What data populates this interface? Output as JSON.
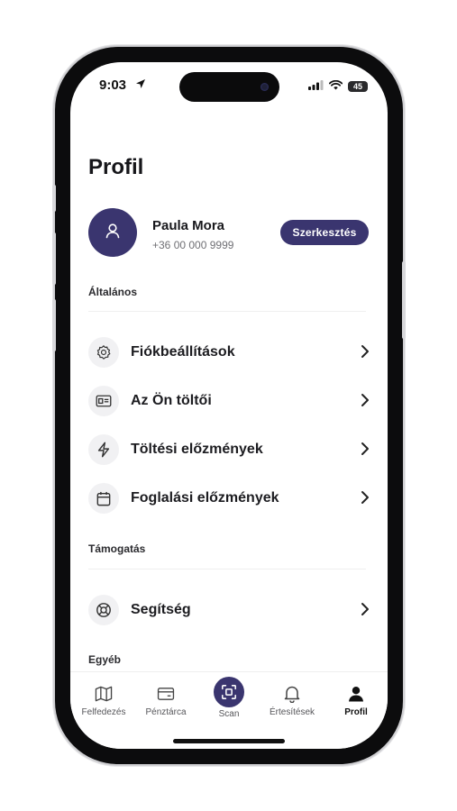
{
  "status": {
    "time": "9:03",
    "battery": "45"
  },
  "page": {
    "title": "Profil"
  },
  "profile": {
    "name": "Paula Mora",
    "phone": "+36 00 000 9999",
    "edit_label": "Szerkesztés"
  },
  "sections": {
    "general": "Általános",
    "support": "Támogatás",
    "other": "Egyéb"
  },
  "menu": {
    "account_settings": "Fiókbeállítások",
    "chargers": "Az Ön töltői",
    "charging_history": "Töltési előzmények",
    "booking_history": "Foglalási előzmények",
    "help": "Segítség"
  },
  "tabs": {
    "explore": "Felfedezés",
    "wallet": "Pénztárca",
    "scan": "Scan",
    "notifications": "Értesítések",
    "profile": "Profil"
  },
  "colors": {
    "accent": "#3a356f",
    "text": "#1b1b1f",
    "muted": "#707075"
  },
  "icons": {
    "account_settings": "gear-icon",
    "chargers": "id-card-icon",
    "charging_history": "lightning-icon",
    "booking_history": "calendar-icon",
    "help": "lifebuoy-icon"
  }
}
